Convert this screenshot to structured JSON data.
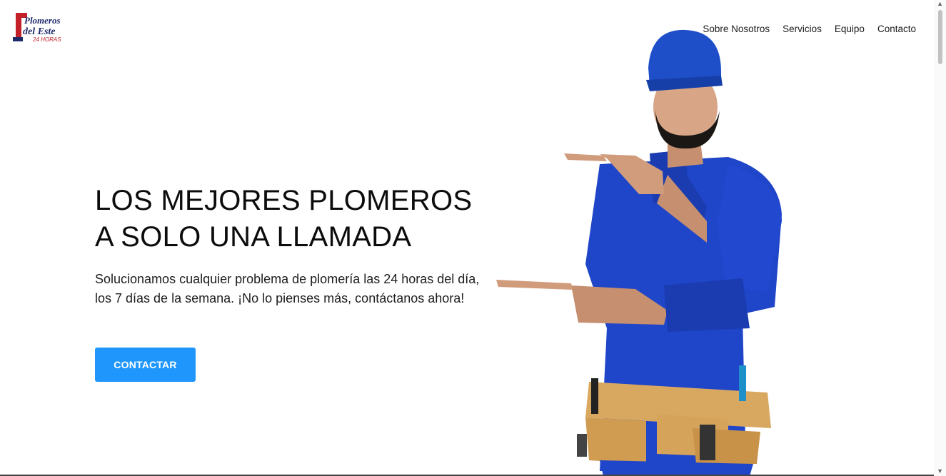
{
  "brand": {
    "logo_line1": "Plomeros",
    "logo_line2": "del Este",
    "logo_line3": "24 HORAS"
  },
  "nav": [
    {
      "label": "Sobre Nosotros"
    },
    {
      "label": "Servicios"
    },
    {
      "label": "Equipo"
    },
    {
      "label": "Contacto"
    }
  ],
  "hero": {
    "title_line1": "LOS MEJORES PLOMEROS",
    "title_line2": "A SOLO UNA LLAMADA",
    "subtitle": "Solucionamos cualquier problema de plomería las 24 horas del día, los 7 días de la semana. ¡No lo pienses más, contáctanos ahora!",
    "cta_label": "CONTACTAR"
  },
  "colors": {
    "accent": "#1e96fc",
    "uniform": "#1f45c8",
    "belt": "#d9a860"
  }
}
